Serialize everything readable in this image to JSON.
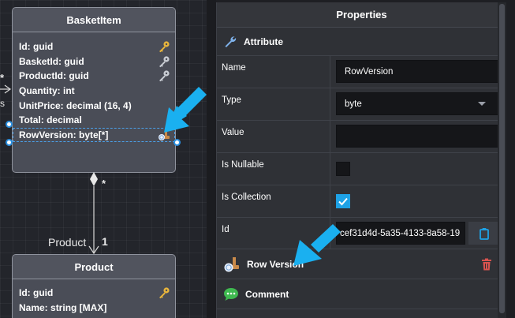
{
  "canvas": {
    "basket_item": {
      "title": "BasketItem",
      "attributes": [
        {
          "label": "Id: guid",
          "icon": "key-gold-icon"
        },
        {
          "label": "BasketId: guid",
          "icon": "key-grey-icon"
        },
        {
          "label": "ProductId: guid",
          "icon": "key-grey-icon"
        },
        {
          "label": "Quantity: int",
          "icon": ""
        },
        {
          "label": "UnitPrice: decimal (16, 4)",
          "icon": ""
        },
        {
          "label": "Total: decimal",
          "icon": ""
        },
        {
          "label": "RowVersion: byte[*]",
          "icon": "row-version-icon"
        }
      ]
    },
    "product": {
      "title": "Product",
      "attributes": [
        {
          "label": "Id: guid",
          "icon": "key-gold-icon"
        },
        {
          "label": "Name: string [MAX]",
          "icon": ""
        }
      ]
    },
    "association": {
      "source_multiplicity": "*",
      "target_role": "Product",
      "target_multiplicity": "1",
      "left_star": "*",
      "left_s": "s"
    }
  },
  "panel": {
    "title": "Properties",
    "attribute_section": "Attribute",
    "fields": {
      "name_label": "Name",
      "name_value": "RowVersion",
      "type_label": "Type",
      "type_value": "byte",
      "value_label": "Value",
      "value_value": "",
      "nullable_label": "Is Nullable",
      "is_nullable": false,
      "collection_label": "Is Collection",
      "is_collection": true,
      "id_label": "Id",
      "id_value": "cef31d4d-5a35-4133-8a58-19"
    },
    "stereotype_section": "Row Version",
    "comment_section": "Comment"
  },
  "colors": {
    "accent": "#1ea2e6",
    "callout_arrow": "#1ab0f0",
    "key_gold": "#e8b53c",
    "delete_red": "#d9534f",
    "comment_green": "#3fb950"
  }
}
